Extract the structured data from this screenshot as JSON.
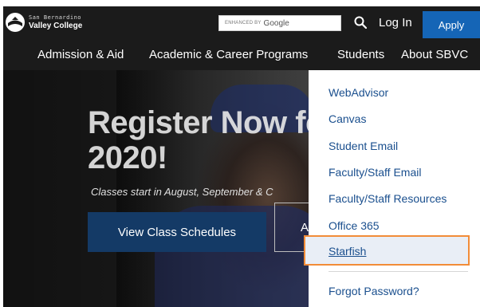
{
  "header": {
    "logo": {
      "line1": "San Bernardino",
      "line2": "Valley College"
    },
    "search": {
      "prefix": "ENHANCED BY",
      "brand": "Google"
    },
    "login_label": "Log In",
    "apply_label": "Apply"
  },
  "nav": {
    "items": [
      {
        "label": "Admission & Aid"
      },
      {
        "label": "Academic & Career Programs"
      },
      {
        "label": "Students"
      },
      {
        "label": "About SBVC"
      }
    ]
  },
  "hero": {
    "title_line1": "Register Now fo",
    "title_line2": "2020!",
    "subtitle": "Classes start in August, September & C",
    "primary_button": "View Class Schedules",
    "secondary_button": "A"
  },
  "dropdown": {
    "items": [
      {
        "label": "WebAdvisor"
      },
      {
        "label": "Canvas"
      },
      {
        "label": "Student Email"
      },
      {
        "label": "Faculty/Staff Email"
      },
      {
        "label": "Faculty/Staff Resources"
      },
      {
        "label": "Office 365"
      },
      {
        "label": "Starfish"
      },
      {
        "label": "Forgot Password?"
      }
    ]
  },
  "colors": {
    "header_bg": "#1b1b1b",
    "apply_bg": "#1565b6",
    "link": "#1a4f8e",
    "highlight_border": "#f28c38",
    "cta_bg": "#143a66"
  },
  "icons": {
    "logo": "college-seal-icon",
    "search": "search-icon"
  }
}
